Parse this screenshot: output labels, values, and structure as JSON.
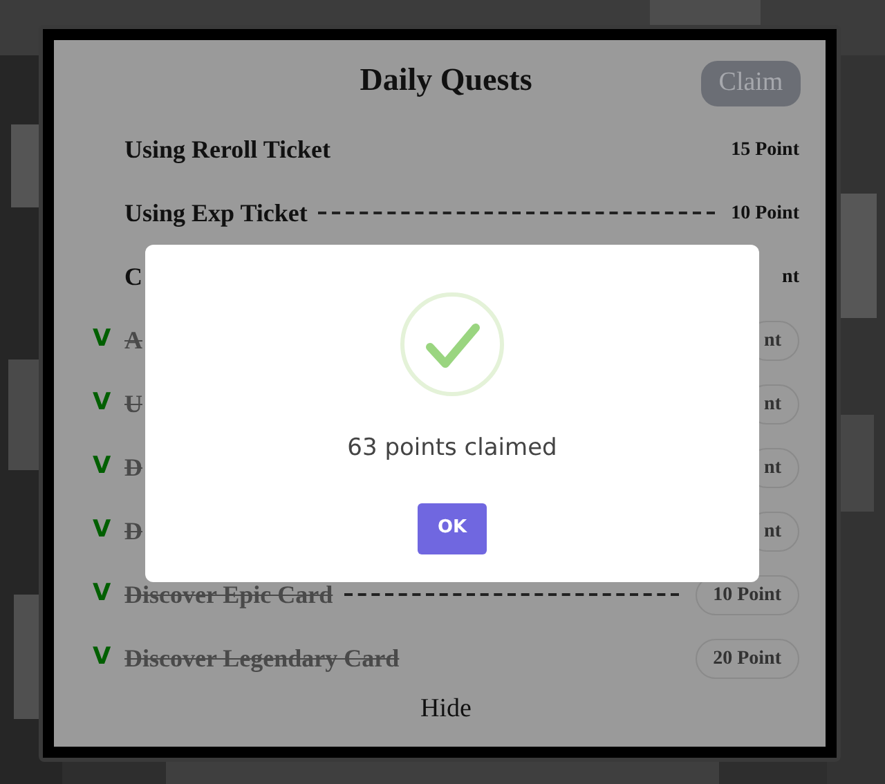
{
  "panel": {
    "title": "Daily Quests",
    "claim_button": "Claim",
    "hide_button": "Hide"
  },
  "quests": [
    {
      "label": "Using Reroll Ticket",
      "points": "15 Point",
      "leader": false
    },
    {
      "label": "Using Exp Ticket",
      "points": "10 Point",
      "leader": true
    },
    {
      "label": "C",
      "points": "nt",
      "leader": false
    },
    {
      "check": "V",
      "label": "A",
      "points": "nt",
      "leader": false
    },
    {
      "check": "V",
      "label": "U",
      "points": "nt",
      "leader": false
    },
    {
      "check": "V",
      "label": "D",
      "points": "nt",
      "leader": false
    },
    {
      "check": "V",
      "label": "D",
      "points": "nt",
      "leader": false
    },
    {
      "check": "V",
      "label": "Discover Epic Card",
      "points": "10 Point",
      "leader": true
    },
    {
      "check": "V",
      "label": "Discover Legendary Card",
      "points": "20 Point",
      "leader": false
    }
  ],
  "dialog": {
    "message": "63 points claimed",
    "ok_button": "OK"
  }
}
